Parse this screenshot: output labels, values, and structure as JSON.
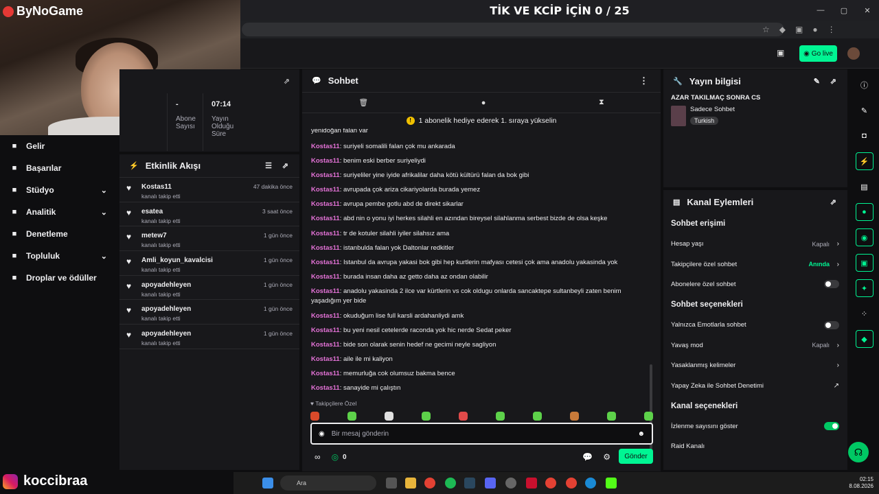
{
  "overlay": {
    "title": "TİK VE KCİP İÇİN 0 / 25",
    "brand": "ByNoGame",
    "channel": "koccibraa"
  },
  "window_controls": [
    "—",
    "▢",
    "✕"
  ],
  "header": {
    "go_live": "Go live"
  },
  "nav": [
    {
      "label": "Gelir",
      "icon": "money-icon"
    },
    {
      "label": "Başarılar",
      "icon": "trophy-icon"
    },
    {
      "label": "Stüdyo",
      "icon": "studio-icon",
      "chevron": true
    },
    {
      "label": "Analitik",
      "icon": "analytics-icon",
      "chevron": true
    },
    {
      "label": "Denetleme",
      "icon": "wrench-icon"
    },
    {
      "label": "Topluluk",
      "icon": "community-icon",
      "chevron": true
    },
    {
      "label": "Droplar ve ödüller",
      "icon": "gift-icon"
    }
  ],
  "stats": {
    "cells": [
      {
        "value": "-",
        "label": "Abone Sayısı"
      },
      {
        "value": "07:14",
        "label": "Yayın Olduğu Süre"
      }
    ]
  },
  "activity": {
    "title": "Etkinlik Akışı",
    "items": [
      {
        "name": "Kostas11",
        "action": "kanalı takip etti",
        "time": "47 dakika önce"
      },
      {
        "name": "esatea",
        "action": "kanalı takip etti",
        "time": "3 saat önce"
      },
      {
        "name": "metew7",
        "action": "kanalı takip etti",
        "time": "1 gün önce"
      },
      {
        "name": "Amli_koyun_kavalcisi",
        "action": "kanalı takip etti",
        "time": "1 gün önce"
      },
      {
        "name": "apoyadehleyen",
        "action": "kanalı takip etti",
        "time": "1 gün önce"
      },
      {
        "name": "apoyadehleyen",
        "action": "kanalı takip etti",
        "time": "1 gün önce"
      },
      {
        "name": "apoyadehleyen",
        "action": "kanalı takip etti",
        "time": "1 gün önce"
      }
    ]
  },
  "chat": {
    "title": "Sohbet",
    "banner": "1 abonelik hediye ederek 1. sıraya yükselin",
    "partial": "yenidoğan falan var",
    "messages": [
      {
        "user": "Kostas11",
        "text": "suriyeli somalili falan çok mu ankarada"
      },
      {
        "user": "Kostas11",
        "text": "benim eski berber suriyeliydi"
      },
      {
        "user": "Kostas11",
        "text": "suriyeliler yine iyide afrikalilar daha kötü kültürü falan da bok gibi"
      },
      {
        "user": "Kostas11",
        "text": "avrupada çok ariza cikariyolarda burada yemez"
      },
      {
        "user": "Kostas11",
        "text": "avrupa pembe gotlu abd de direkt sikarlar"
      },
      {
        "user": "Kostas11",
        "text": "abd nin o yonu iyi herkes silahli en azından bireysel silahlanma serbest bizde de olsa keşke"
      },
      {
        "user": "Kostas11",
        "text": "tr de kotuler silahli iyiler silahsız ama"
      },
      {
        "user": "Kostas11",
        "text": "istanbulda falan yok Daltonlar redkitler"
      },
      {
        "user": "Kostas11",
        "text": "Istanbul da avrupa yakasi bok gibi hep kurtlerin mafyası cetesi çok ama anadolu yakasinda yok"
      },
      {
        "user": "Kostas11",
        "text": "burada insan daha az getto daha az ondan olabilir"
      },
      {
        "user": "Kostas11",
        "text": "anadolu yakasinda 2 ilce var kürtlerin vs cok oldugu onlarda sancaktepe sultanbeyli zaten benim yaşadığım yer bide"
      },
      {
        "user": "Kostas11",
        "text": "okuduğum lise full karsli ardahanliydi amk"
      },
      {
        "user": "Kostas11",
        "text": "bu yeni nesil cetelerde raconda yok hic nerde Sedat peker"
      },
      {
        "user": "Kostas11",
        "text": "bide son olarak senin hedef ne gecimi neyle sagliyon"
      },
      {
        "user": "Kostas11",
        "text": "aile ile mi kaliyon"
      },
      {
        "user": "Kostas11",
        "text": "memurluğa cok olumsuz bakma bence"
      },
      {
        "user": "Kostas11",
        "text": "sanayide mi çalıştın"
      }
    ],
    "followers_only": "Takipçilere Özel",
    "placeholder": "Bir mesaj gönderin",
    "points": "0",
    "send": "Gönder"
  },
  "stream_info": {
    "title": "Yayın bilgisi",
    "stream_title": "AZAR TAKILMAÇ SONRA CS",
    "category": "Sadece Sohbet",
    "tag": "Turkish"
  },
  "channel_actions": {
    "title": "Kanal Eylemleri",
    "sections": [
      {
        "title": "Sohbet erişimi",
        "rows": [
          {
            "label": "Hesap yaşı",
            "value": "Kapalı",
            "type": "chevron"
          },
          {
            "label": "Takipçilere özel sohbet",
            "value": "Anında",
            "type": "chevron",
            "accent": true
          },
          {
            "label": "Abonelere özel sohbet",
            "value": "",
            "type": "toggle",
            "on": false
          }
        ]
      },
      {
        "title": "Sohbet seçenekleri",
        "rows": [
          {
            "label": "Yalnızca Emotlarla sohbet",
            "value": "",
            "type": "toggle",
            "on": false
          },
          {
            "label": "Yavaş mod",
            "value": "Kapalı",
            "type": "chevron"
          },
          {
            "label": "Yasaklanmış kelimeler",
            "value": "",
            "type": "chevron"
          },
          {
            "label": "Yapay Zeka ile Sohbet Denetimi",
            "value": "",
            "type": "external"
          }
        ]
      },
      {
        "title": "Kanal seçenekleri",
        "rows": [
          {
            "label": "İzlenme sayısını göster",
            "value": "",
            "type": "toggle",
            "on": true
          },
          {
            "label": "Raid Kanalı",
            "value": "",
            "type": "none"
          }
        ]
      }
    ]
  },
  "taskbar": {
    "search": "Ara",
    "time": "02:15",
    "date": "8.08.2026"
  },
  "colors": {
    "accent": "#00f593",
    "username": "#e573d8",
    "panel": "#18181b",
    "bg": "#0e0e10"
  }
}
